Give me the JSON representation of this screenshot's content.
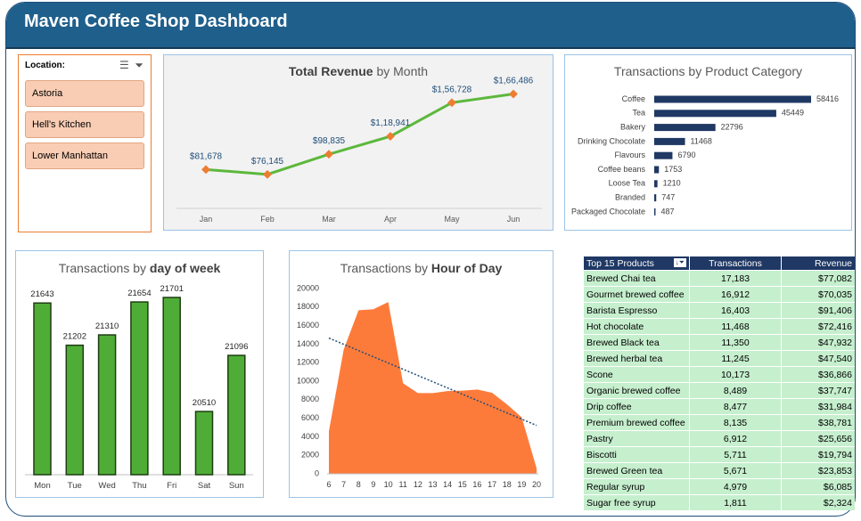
{
  "header": {
    "title": "Maven Coffee Shop Dashboard"
  },
  "slicer": {
    "label": "Location:",
    "items": [
      "Astoria",
      "Hell's Kitchen",
      "Lower Manhattan"
    ]
  },
  "colors": {
    "header": "#1f5f8b",
    "line": "#5cb83c",
    "marker": "#ed7d31",
    "bar_green": "#4fad37",
    "bar_navy": "#1f3864",
    "area": "#fd7b3a",
    "table_row": "#c6efce"
  },
  "icons": [
    "multi-select-icon",
    "clear-filter-icon",
    "sort-filter-icon"
  ],
  "revenue_chart": {
    "title_bold": "Total Revenue",
    "title_rest": " by Month",
    "labels": [
      "$81,678",
      "$76,145",
      "$98,835",
      "$1,18,941",
      "$1,56,728",
      "$1,66,486"
    ]
  },
  "category_chart": {
    "title": "Transactions by Product Category"
  },
  "dow_chart": {
    "title_plain": "Transactions by ",
    "title_bold": "day of week"
  },
  "hour_chart": {
    "title_plain": "Transactions by ",
    "title_bold": "Hour of Day"
  },
  "table": {
    "headers": [
      "Top 15 Products",
      "Transactions",
      "Revenue"
    ],
    "rows": [
      [
        "Brewed Chai tea",
        "17,183",
        "$77,082"
      ],
      [
        "Gourmet brewed coffee",
        "16,912",
        "$70,035"
      ],
      [
        "Barista Espresso",
        "16,403",
        "$91,406"
      ],
      [
        "Hot chocolate",
        "11,468",
        "$72,416"
      ],
      [
        "Brewed Black tea",
        "11,350",
        "$47,932"
      ],
      [
        "Brewed herbal tea",
        "11,245",
        "$47,540"
      ],
      [
        "Scone",
        "10,173",
        "$36,866"
      ],
      [
        "Organic brewed coffee",
        "8,489",
        "$37,747"
      ],
      [
        "Drip coffee",
        "8,477",
        "$31,984"
      ],
      [
        "Premium brewed coffee",
        "8,135",
        "$38,781"
      ],
      [
        "Pastry",
        "6,912",
        "$25,656"
      ],
      [
        "Biscotti",
        "5,711",
        "$19,794"
      ],
      [
        "Brewed Green tea",
        "5,671",
        "$23,853"
      ],
      [
        "Regular syrup",
        "4,979",
        "$6,085"
      ],
      [
        "Sugar free syrup",
        "1,811",
        "$2,324"
      ]
    ]
  },
  "chart_data": [
    {
      "type": "line",
      "title": "Total Revenue by Month",
      "categories": [
        "Jan",
        "Feb",
        "Mar",
        "Apr",
        "May",
        "Jun"
      ],
      "values": [
        81678,
        76145,
        98835,
        118941,
        156728,
        166486
      ],
      "grid": false
    },
    {
      "type": "bar",
      "orientation": "horizontal",
      "title": "Transactions by Product Category",
      "categories": [
        "Coffee",
        "Tea",
        "Bakery",
        "Drinking Chocolate",
        "Flavours",
        "Coffee beans",
        "Loose Tea",
        "Branded",
        "Packaged Chocolate"
      ],
      "values": [
        58416,
        45449,
        22796,
        11468,
        6790,
        1753,
        1210,
        747,
        487
      ]
    },
    {
      "type": "bar",
      "title": "Transactions by day of week",
      "categories": [
        "Mon",
        "Tue",
        "Wed",
        "Thu",
        "Fri",
        "Sat",
        "Sun"
      ],
      "values": [
        21643,
        21202,
        21310,
        21654,
        21701,
        20510,
        21096
      ]
    },
    {
      "type": "area",
      "title": "Transactions by Hour of Day",
      "x": [
        6,
        7,
        8,
        9,
        10,
        11,
        12,
        13,
        14,
        15,
        16,
        17,
        18,
        19,
        20
      ],
      "values": [
        4594,
        13428,
        17654,
        17764,
        18545,
        9766,
        8708,
        8714,
        8933,
        8979,
        9093,
        8745,
        7498,
        6092,
        603
      ],
      "ylim": [
        0,
        20000
      ],
      "yticks": [
        0,
        2000,
        4000,
        6000,
        8000,
        10000,
        12000,
        14000,
        16000,
        18000,
        20000
      ],
      "trendline": "linear",
      "grid": false
    }
  ]
}
